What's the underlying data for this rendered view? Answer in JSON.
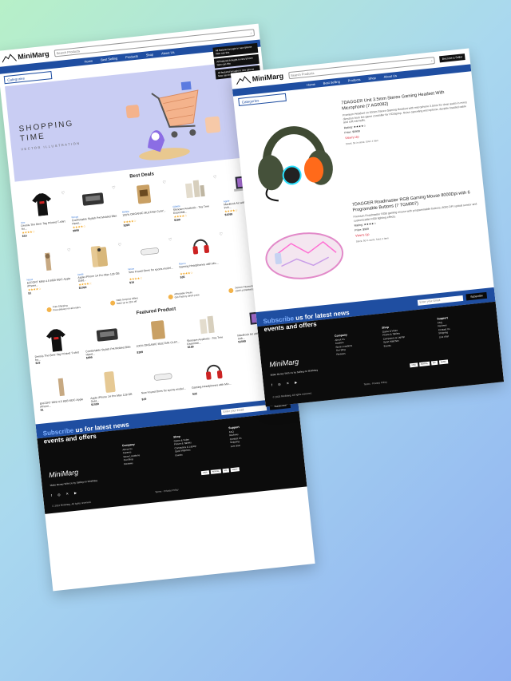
{
  "brand": {
    "name": "MiniMarg"
  },
  "header": {
    "search_placeholder": "Search Products",
    "nav": [
      "Home",
      "Best Selling",
      "Products",
      "Shop",
      "About Us"
    ],
    "categories_label": "Categories",
    "account_label": "Become a Seller"
  },
  "hero": {
    "title_line1": "SHOPPING",
    "title_line2": "TIME",
    "subtitle": "VECTOR ILLUSTRATION"
  },
  "best_deals": {
    "title": "Best Deals",
    "products": [
      {
        "brand": "Xoo",
        "name": "Dennis The Beer Tag Printed T-shirt for...",
        "price": "$19",
        "stars": "★★★★☆"
      },
      {
        "brand": "Wrogn",
        "name": "Comfortable Stylish Pet Molded Bike Hand...",
        "price": "$999",
        "stars": "★★★★☆"
      },
      {
        "brand": "Mithila",
        "name": "100% ORGANIC MULTANI CLAY...",
        "price": "$399",
        "stars": "★★★★☆"
      },
      {
        "brand": "Gillette",
        "name": "Skincare Aesthetic - Tea Tree Essential...",
        "price": "$189",
        "stars": "★★★★☆"
      },
      {
        "brand": "Apple",
        "name": "MacBook Air with Apple M2 Chip 13 inch...",
        "price": "$1099",
        "stars": "★★★★☆"
      },
      {
        "brand": "Noise",
        "name": "EFFORT MINI 4.5 8GB MDC Apple iPhone...",
        "price": "$1",
        "stars": "★★★★☆"
      },
      {
        "brand": "Apple",
        "name": "Apple iPhone 14 Pro Max 128 GB Gold...",
        "price": "$1099",
        "stars": "★★★★☆"
      },
      {
        "brand": "Noise",
        "name": "New Found Ones for sports model...",
        "price": "$19",
        "stars": "★★★★☆"
      },
      {
        "brand": "Ravon",
        "name": "Gaming Headphones with Mic...",
        "price": "$35",
        "stars": "★★★★☆"
      }
    ]
  },
  "features": [
    {
      "title": "Free Shipping",
      "desc": "Free delivery on all orders"
    },
    {
      "title": "Daily Surprise Offers",
      "desc": "Save up to 25% off"
    },
    {
      "title": "Affordable Prices",
      "desc": "Get Factory direct price"
    },
    {
      "title": "Secure Payments",
      "desc": "100% protected payments"
    }
  ],
  "featured": {
    "title": "Featured Product"
  },
  "annotations": [
    "All featured brought in new Iphone New can this",
    "All featured brought in new Iphone New can this",
    "All featured brought in new Iphone New can this"
  ],
  "subscribe": {
    "placeholder": "Enter your Email",
    "button": "Subscribe",
    "headline_highlight": "Subscribe",
    "headline_rest": " us for latest news events and offers"
  },
  "footer": {
    "tagline": "Make Money With Us by Selling on MiniMarg",
    "company": {
      "title": "Company",
      "items": [
        "About Us",
        "Careers",
        "Store Locations",
        "Our Blog",
        "Reviews"
      ]
    },
    "shop": {
      "title": "Shop",
      "items": [
        "Game & Video",
        "Phone & Tablets",
        "Computers & Laptop",
        "Sport Watches",
        "Events"
      ]
    },
    "support": {
      "title": "Support",
      "items": [
        "FAQ",
        "Reviews",
        "Contact Us",
        "Shipping",
        "Live chat"
      ]
    },
    "social": "f ◎ ✕ ▶",
    "copyright": "© 2023 MiniMarg. All rights reserved.",
    "terms": "Terms · Privacy Policy",
    "payments": [
      "VISA",
      "PAYPAL",
      "MC",
      "AMEX"
    ]
  },
  "product_list": [
    {
      "title": "7DAGGER Unit 3.5mm Stereo Gaming Headset With Microphone (7 AG0082)",
      "desc": "Premium Headset on 60mm Stereo Gaming Headset with microphone 3.5mm for clear audio in every direction from the game controller for PC/laptop. Noise canceling microphone, durable braided cable and soft earmuffs.",
      "rating": "Rating: ★★★★☆",
      "price": "Price: $3999",
      "action": "View's Up",
      "meta": "Stock: 50 in stock; Sold: 4 Item"
    },
    {
      "title": "7DAGGER Roadmaster RGB Gaming Mouse 8000Dpi with 6 Programable Buttons (7 TGM007)",
      "desc": "Premium Roadmaster RGB gaming mouse with programmable buttons, 8000 DPI optical sensor and customizable RGB lighting effects.",
      "rating": "Rating: ★★★★☆",
      "price": "Price: $999",
      "action": "View's Up",
      "meta": "Stock: 50 in stock; Sold: 2 Item"
    }
  ]
}
